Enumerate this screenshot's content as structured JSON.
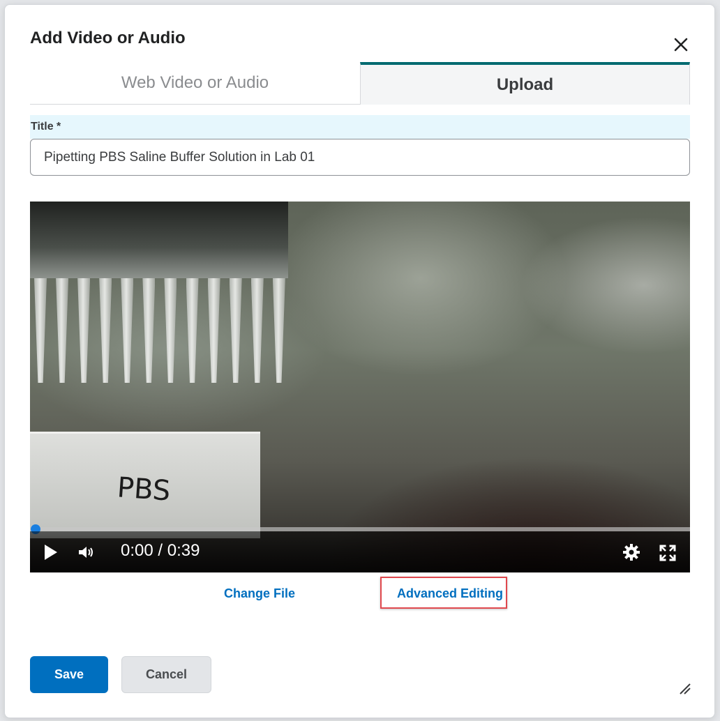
{
  "dialog": {
    "title": "Add Video or Audio",
    "close_icon": "close-icon"
  },
  "tabs": [
    {
      "label": "Web Video or Audio",
      "selected": false
    },
    {
      "label": "Upload",
      "selected": true
    }
  ],
  "form": {
    "title_label": "Title *",
    "title_value": "Pipetting PBS Saline Buffer Solution in Lab 01"
  },
  "video": {
    "frame_label": "PBS",
    "current_time": "0:00",
    "duration": "0:39",
    "time_display": "0:00 / 0:39",
    "progress": 0,
    "icons": [
      "play-icon",
      "volume-icon",
      "settings-gear-icon",
      "fullscreen-icon"
    ]
  },
  "links": {
    "change_file": "Change File",
    "advanced_editing": "Advanced Editing"
  },
  "buttons": {
    "save": "Save",
    "cancel": "Cancel"
  },
  "colors": {
    "accent": "#006fbf",
    "tab_indicator": "#006a70",
    "highlight": "#e0484e",
    "label_bg": "#e6f7fd"
  }
}
